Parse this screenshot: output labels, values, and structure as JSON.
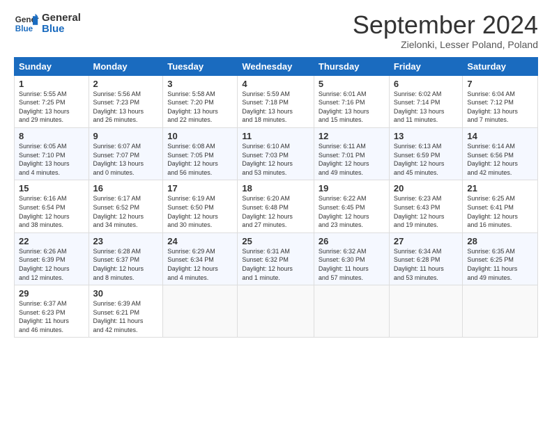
{
  "header": {
    "logo_line1": "General",
    "logo_line2": "Blue",
    "month_title": "September 2024",
    "location": "Zielonki, Lesser Poland, Poland"
  },
  "weekdays": [
    "Sunday",
    "Monday",
    "Tuesday",
    "Wednesday",
    "Thursday",
    "Friday",
    "Saturday"
  ],
  "weeks": [
    [
      {
        "day": "1",
        "lines": [
          "Sunrise: 5:55 AM",
          "Sunset: 7:25 PM",
          "Daylight: 13 hours",
          "and 29 minutes."
        ]
      },
      {
        "day": "2",
        "lines": [
          "Sunrise: 5:56 AM",
          "Sunset: 7:23 PM",
          "Daylight: 13 hours",
          "and 26 minutes."
        ]
      },
      {
        "day": "3",
        "lines": [
          "Sunrise: 5:58 AM",
          "Sunset: 7:20 PM",
          "Daylight: 13 hours",
          "and 22 minutes."
        ]
      },
      {
        "day": "4",
        "lines": [
          "Sunrise: 5:59 AM",
          "Sunset: 7:18 PM",
          "Daylight: 13 hours",
          "and 18 minutes."
        ]
      },
      {
        "day": "5",
        "lines": [
          "Sunrise: 6:01 AM",
          "Sunset: 7:16 PM",
          "Daylight: 13 hours",
          "and 15 minutes."
        ]
      },
      {
        "day": "6",
        "lines": [
          "Sunrise: 6:02 AM",
          "Sunset: 7:14 PM",
          "Daylight: 13 hours",
          "and 11 minutes."
        ]
      },
      {
        "day": "7",
        "lines": [
          "Sunrise: 6:04 AM",
          "Sunset: 7:12 PM",
          "Daylight: 13 hours",
          "and 7 minutes."
        ]
      }
    ],
    [
      {
        "day": "8",
        "lines": [
          "Sunrise: 6:05 AM",
          "Sunset: 7:10 PM",
          "Daylight: 13 hours",
          "and 4 minutes."
        ]
      },
      {
        "day": "9",
        "lines": [
          "Sunrise: 6:07 AM",
          "Sunset: 7:07 PM",
          "Daylight: 13 hours",
          "and 0 minutes."
        ]
      },
      {
        "day": "10",
        "lines": [
          "Sunrise: 6:08 AM",
          "Sunset: 7:05 PM",
          "Daylight: 12 hours",
          "and 56 minutes."
        ]
      },
      {
        "day": "11",
        "lines": [
          "Sunrise: 6:10 AM",
          "Sunset: 7:03 PM",
          "Daylight: 12 hours",
          "and 53 minutes."
        ]
      },
      {
        "day": "12",
        "lines": [
          "Sunrise: 6:11 AM",
          "Sunset: 7:01 PM",
          "Daylight: 12 hours",
          "and 49 minutes."
        ]
      },
      {
        "day": "13",
        "lines": [
          "Sunrise: 6:13 AM",
          "Sunset: 6:59 PM",
          "Daylight: 12 hours",
          "and 45 minutes."
        ]
      },
      {
        "day": "14",
        "lines": [
          "Sunrise: 6:14 AM",
          "Sunset: 6:56 PM",
          "Daylight: 12 hours",
          "and 42 minutes."
        ]
      }
    ],
    [
      {
        "day": "15",
        "lines": [
          "Sunrise: 6:16 AM",
          "Sunset: 6:54 PM",
          "Daylight: 12 hours",
          "and 38 minutes."
        ]
      },
      {
        "day": "16",
        "lines": [
          "Sunrise: 6:17 AM",
          "Sunset: 6:52 PM",
          "Daylight: 12 hours",
          "and 34 minutes."
        ]
      },
      {
        "day": "17",
        "lines": [
          "Sunrise: 6:19 AM",
          "Sunset: 6:50 PM",
          "Daylight: 12 hours",
          "and 30 minutes."
        ]
      },
      {
        "day": "18",
        "lines": [
          "Sunrise: 6:20 AM",
          "Sunset: 6:48 PM",
          "Daylight: 12 hours",
          "and 27 minutes."
        ]
      },
      {
        "day": "19",
        "lines": [
          "Sunrise: 6:22 AM",
          "Sunset: 6:45 PM",
          "Daylight: 12 hours",
          "and 23 minutes."
        ]
      },
      {
        "day": "20",
        "lines": [
          "Sunrise: 6:23 AM",
          "Sunset: 6:43 PM",
          "Daylight: 12 hours",
          "and 19 minutes."
        ]
      },
      {
        "day": "21",
        "lines": [
          "Sunrise: 6:25 AM",
          "Sunset: 6:41 PM",
          "Daylight: 12 hours",
          "and 16 minutes."
        ]
      }
    ],
    [
      {
        "day": "22",
        "lines": [
          "Sunrise: 6:26 AM",
          "Sunset: 6:39 PM",
          "Daylight: 12 hours",
          "and 12 minutes."
        ]
      },
      {
        "day": "23",
        "lines": [
          "Sunrise: 6:28 AM",
          "Sunset: 6:37 PM",
          "Daylight: 12 hours",
          "and 8 minutes."
        ]
      },
      {
        "day": "24",
        "lines": [
          "Sunrise: 6:29 AM",
          "Sunset: 6:34 PM",
          "Daylight: 12 hours",
          "and 4 minutes."
        ]
      },
      {
        "day": "25",
        "lines": [
          "Sunrise: 6:31 AM",
          "Sunset: 6:32 PM",
          "Daylight: 12 hours",
          "and 1 minute."
        ]
      },
      {
        "day": "26",
        "lines": [
          "Sunrise: 6:32 AM",
          "Sunset: 6:30 PM",
          "Daylight: 11 hours",
          "and 57 minutes."
        ]
      },
      {
        "day": "27",
        "lines": [
          "Sunrise: 6:34 AM",
          "Sunset: 6:28 PM",
          "Daylight: 11 hours",
          "and 53 minutes."
        ]
      },
      {
        "day": "28",
        "lines": [
          "Sunrise: 6:35 AM",
          "Sunset: 6:25 PM",
          "Daylight: 11 hours",
          "and 49 minutes."
        ]
      }
    ],
    [
      {
        "day": "29",
        "lines": [
          "Sunrise: 6:37 AM",
          "Sunset: 6:23 PM",
          "Daylight: 11 hours",
          "and 46 minutes."
        ]
      },
      {
        "day": "30",
        "lines": [
          "Sunrise: 6:39 AM",
          "Sunset: 6:21 PM",
          "Daylight: 11 hours",
          "and 42 minutes."
        ]
      },
      {
        "day": "",
        "lines": []
      },
      {
        "day": "",
        "lines": []
      },
      {
        "day": "",
        "lines": []
      },
      {
        "day": "",
        "lines": []
      },
      {
        "day": "",
        "lines": []
      }
    ]
  ]
}
